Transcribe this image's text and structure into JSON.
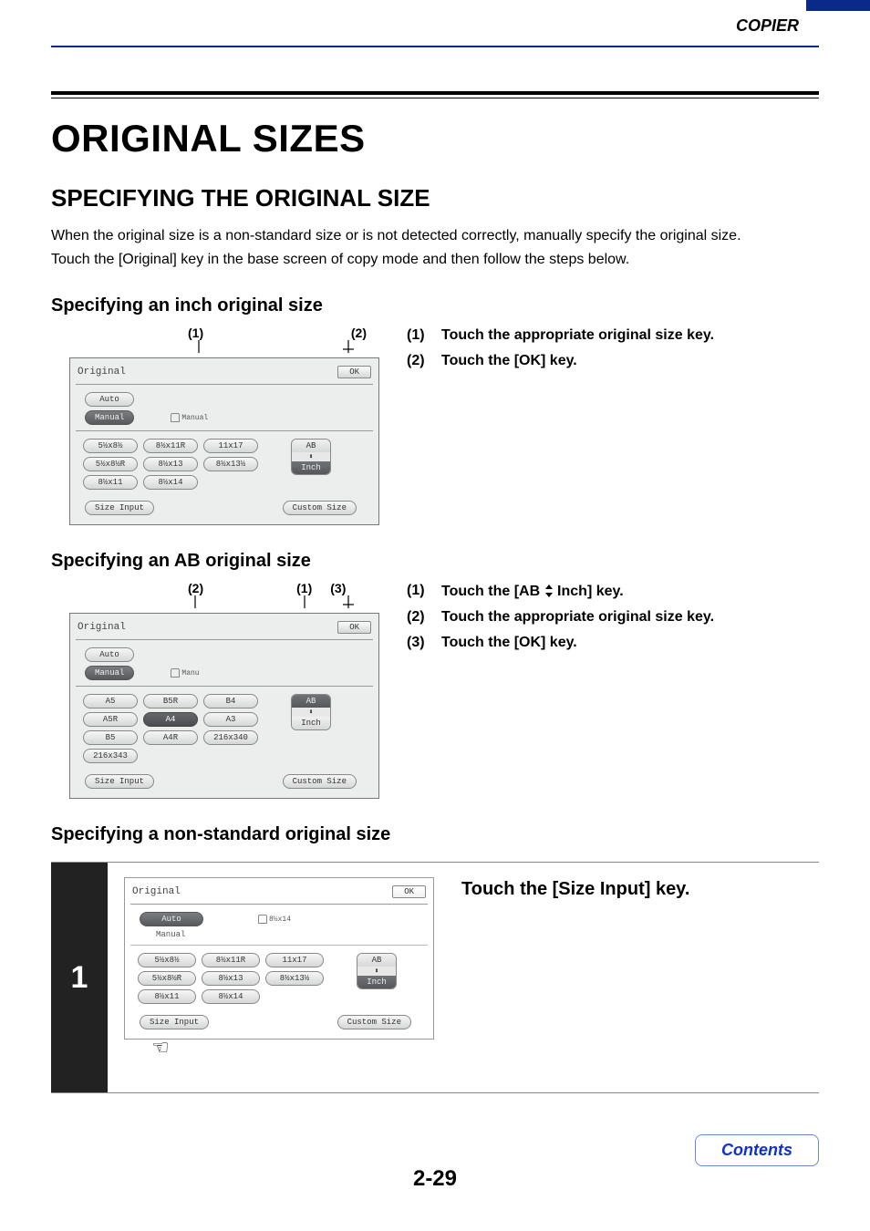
{
  "header": {
    "corner": "COPIER"
  },
  "title": "ORIGINAL SIZES",
  "section": "SPECIFYING THE ORIGINAL SIZE",
  "intro1": "When the original size is a non-standard size or is not detected correctly, manually specify the original size.",
  "intro2": "Touch the [Original] key in the base screen of copy mode and then follow the steps below.",
  "sub1": "Specifying an inch original size",
  "sub2": "Specifying an AB original size",
  "sub3": "Specifying a non-standard original size",
  "callout_1": "(1)",
  "callout_2": "(2)",
  "callout_3": "(3)",
  "panel": {
    "title": "Original",
    "ok": "OK",
    "auto": "Auto",
    "manual": "Manual",
    "manual_tab": "Manual",
    "manu_tab": "Manu",
    "size_input": "Size Input",
    "custom_size": "Custom Size",
    "ab": "AB",
    "inch": "Inch",
    "updown": "⬍"
  },
  "inch_sizes": [
    "5½x8½",
    "8½x11R",
    "11x17",
    "5½x8½R",
    "8½x13",
    "8½x13½",
    "8½x11",
    "8½x14"
  ],
  "ab_sizes": [
    "A5",
    "B5R",
    "B4",
    "A5R",
    "A4",
    "A3",
    "B5",
    "A4R",
    "216x340",
    "216x343"
  ],
  "ns_sizes": [
    "5½x8½",
    "8½x11R",
    "11x17",
    "5½x8½R",
    "8½x13",
    "8½x13½",
    "8½x11",
    "8½x14"
  ],
  "ns_tab_value": "8½x14",
  "steps1": [
    {
      "n": "(1)",
      "t": "Touch the appropriate original size key."
    },
    {
      "n": "(2)",
      "t": "Touch the [OK] key."
    }
  ],
  "steps2_prefix": "Touch the [AB",
  "steps2_suffix": "Inch] key.",
  "steps2_rest": [
    {
      "n": "(2)",
      "t": "Touch the appropriate original size key."
    },
    {
      "n": "(3)",
      "t": "Touch the [OK] key."
    }
  ],
  "step_big": {
    "num": "1",
    "text": "Touch the [Size Input] key."
  },
  "footer": "2-29",
  "contents": "Contents"
}
